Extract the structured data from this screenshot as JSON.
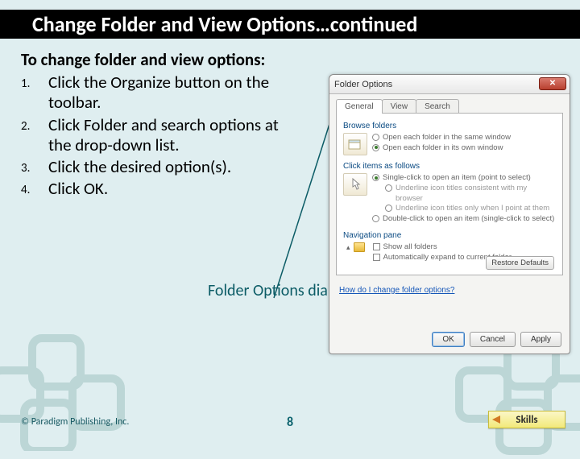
{
  "title": "Change Folder and View Options…continued",
  "intro": "To change folder and view options:",
  "steps": [
    "Click the Organize button on the toolbar.",
    "Click Folder and search options at the drop-down list.",
    "Click the desired option(s).",
    "Click OK."
  ],
  "callout": "Folder Options dialog box",
  "dialog": {
    "title": "Folder Options",
    "tabs": [
      "General",
      "View",
      "Search"
    ],
    "browse": {
      "label": "Browse folders",
      "opt1": "Open each folder in the same window",
      "opt2": "Open each folder in its own window"
    },
    "click": {
      "label": "Click items as follows",
      "opt1": "Single-click to open an item (point to select)",
      "sub1": "Underline icon titles consistent with my browser",
      "sub2": "Underline icon titles only when I point at them",
      "opt2": "Double-click to open an item (single-click to select)"
    },
    "nav": {
      "label": "Navigation pane",
      "opt1": "Show all folders",
      "opt2": "Automatically expand to current folder"
    },
    "restore": "Restore Defaults",
    "help": "How do I change folder options?",
    "ok": "OK",
    "cancel": "Cancel",
    "apply": "Apply"
  },
  "footer": {
    "copyright": "© Paradigm Publishing, Inc.",
    "page": "8",
    "skills": "Skills"
  }
}
